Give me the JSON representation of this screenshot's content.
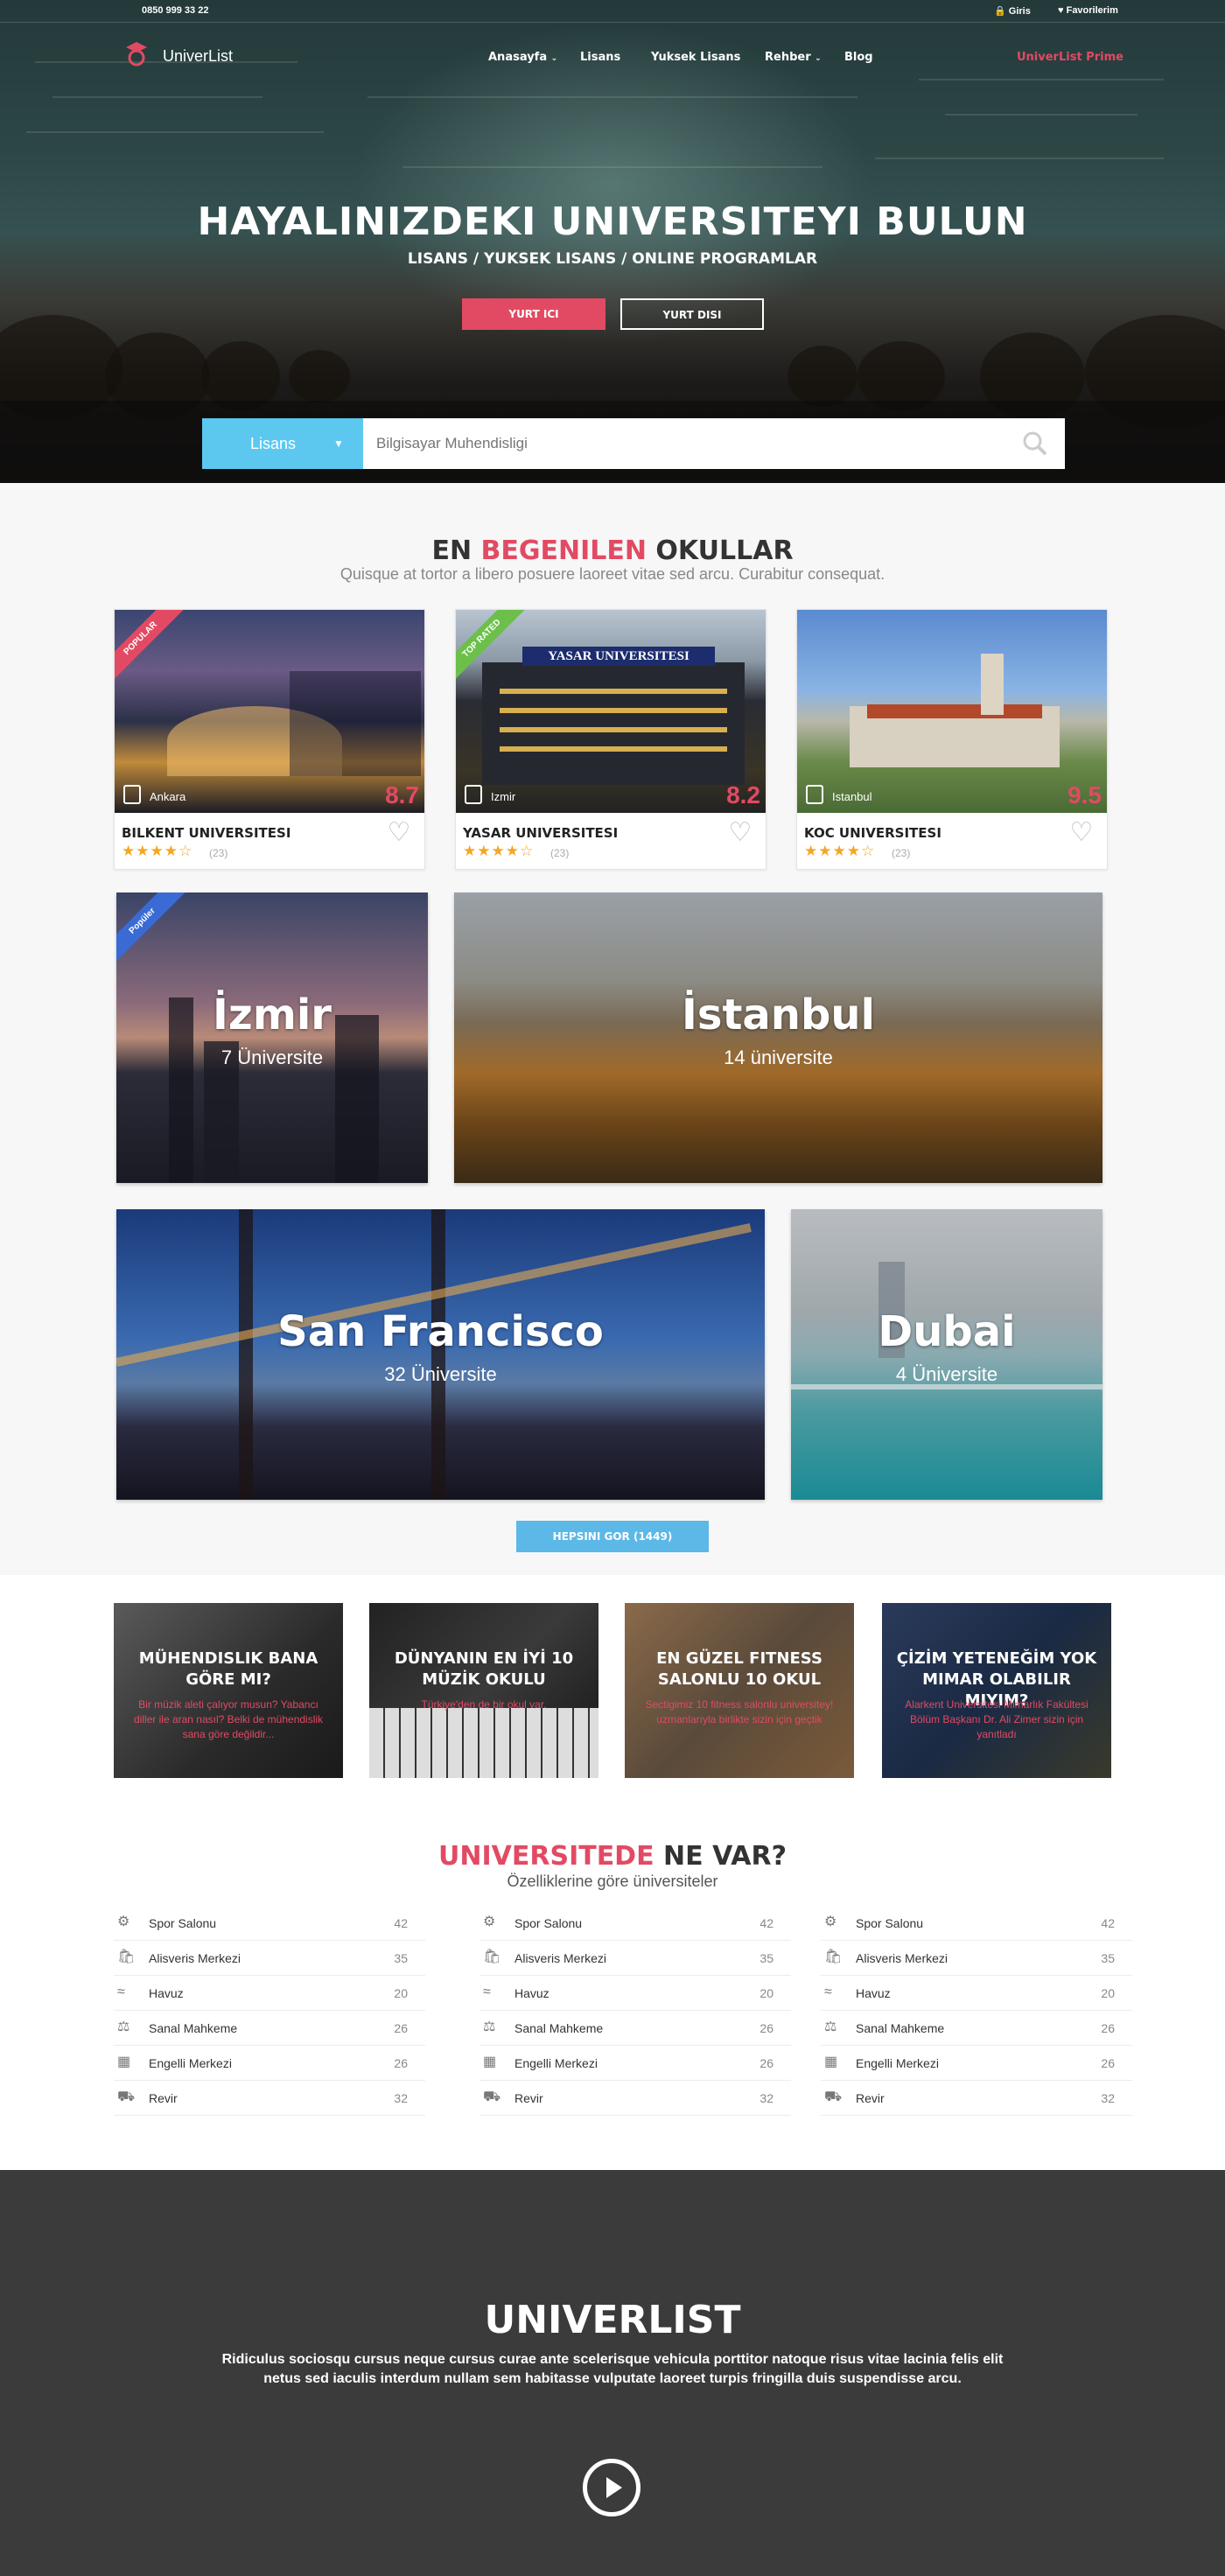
{
  "topbar": {
    "phone": "0850 999 33 22",
    "login": "Giris",
    "favorites": "Favorilerim"
  },
  "header": {
    "logo_text": "UniverList",
    "nav": [
      "Anasayfa",
      "Lisans",
      "Yuksek Lisans",
      "Rehber",
      "Blog"
    ],
    "prime": "UniverList Prime"
  },
  "hero": {
    "title": "HAYALINIZDEKI UNIVERSITEYI BULUN",
    "subtitle": "LISANS / YUKSEK LISANS / ONLINE PROGRAMLAR",
    "btn_domestic": "YURT ICI",
    "btn_abroad": "YURT DISI"
  },
  "search": {
    "type": "Lisans",
    "placeholder": "Bilgisayar Muhendisligi"
  },
  "popular": {
    "title_pre": "EN ",
    "title_highlight": "BEGENILEN",
    "title_post": " OKULLAR",
    "subtitle": "Quisque at tortor a libero posuere laoreet vitae sed arcu. Curabitur consequat.",
    "cards": [
      {
        "ribbon": "POPULAR",
        "city": "Ankara",
        "score": "8.7",
        "name": "BILKENT UNIVERSITESI",
        "stars": "★★★★☆",
        "reviews": "(23)"
      },
      {
        "ribbon": "TOP RATED",
        "city": "Izmir",
        "score": "8.2",
        "name": "YASAR UNIVERSITESI",
        "stars": "★★★★☆",
        "reviews": "(23)",
        "sign": "YASAR UNIVERSITESI"
      },
      {
        "ribbon": "",
        "city": "Istanbul",
        "score": "9.5",
        "name": "KOC UNIVERSITESI",
        "stars": "★★★★☆",
        "reviews": "(23)"
      }
    ]
  },
  "cities": [
    {
      "name": "İzmir",
      "count": "7 Üniversite",
      "ribbon": "Popüler"
    },
    {
      "name": "İstanbul",
      "count": "14 üniversite"
    },
    {
      "name": "San Francisco",
      "count": "32 Üniversite"
    },
    {
      "name": "Dubai",
      "count": "4 Üniversite"
    }
  ],
  "all_button": "HEPSINI GOR (1449)",
  "articles": [
    {
      "title": "MÜHENDISLIK BANA GÖRE MI?",
      "desc": "Bir müzik aleti çalıyor musun? Yabancı diller ile aran nasıl? Belki de mühendislik sana göre değildir..."
    },
    {
      "title": "DÜNYANIN EN İYİ 10 MÜZİK OKULU",
      "desc": "Türkiye'den de bir okul var."
    },
    {
      "title": "EN GÜZEL FITNESS SALONLU 10 OKUL",
      "desc": "Sectigimiz 10 fitness salonlu universitey! uzmanlarıyla birlikte sizin için geçtik"
    },
    {
      "title": "ÇİZİM YETENEĞİM YOK MIMAR OLABILIR MIYIM?",
      "desc": "Alarkent Universitesi Mimarlık Fakültesi Bölüm Başkanı Dr. Ali Zimer sizin için yanıtladı"
    }
  ],
  "features": {
    "title_highlight": "UNIVERSITEDE",
    "title_post": " NE VAR?",
    "subtitle": "Özelliklerine göre üniversiteler",
    "items": [
      {
        "label": "Spor Salonu",
        "count": "42",
        "icon": "gear-icon"
      },
      {
        "label": "Alisveris Merkezi",
        "count": "35",
        "icon": "shopping-bag-icon"
      },
      {
        "label": "Havuz",
        "count": "20",
        "icon": "pool-icon"
      },
      {
        "label": "Sanal Mahkeme",
        "count": "26",
        "icon": "court-icon"
      },
      {
        "label": "Engelli Merkezi",
        "count": "26",
        "icon": "building-icon"
      },
      {
        "label": "Revir",
        "count": "32",
        "icon": "ambulance-icon"
      }
    ]
  },
  "footer": {
    "title": "UNIVERLIST",
    "desc": "Ridiculus sociosqu cursus neque cursus curae ante scelerisque vehicula porttitor natoque risus vitae lacinia felis elit netus sed iaculis interdum nullam sem habitasse vulputate laoreet turpis fringilla duis suspendisse arcu."
  },
  "colors": {
    "accent": "#e24a63",
    "blue": "#5cc8ef",
    "dark": "#3b3b3b"
  }
}
